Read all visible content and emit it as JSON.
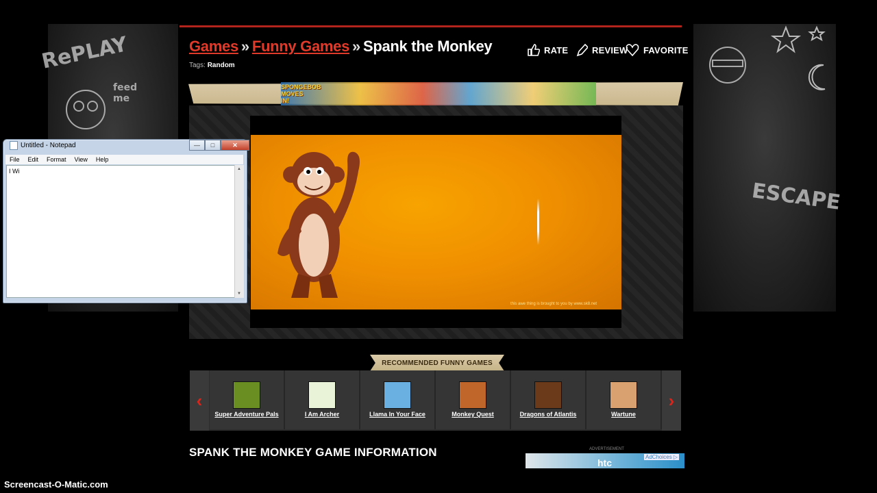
{
  "breadcrumb": {
    "games": "Games",
    "sep1": "»",
    "funny_games": "Funny Games",
    "sep2": "»",
    "current": "Spank the Monkey"
  },
  "tags": {
    "label": "Tags:",
    "value": "Random"
  },
  "actions": {
    "rate": "RATE",
    "review": "REVIEW",
    "favorite": "FAVORITE"
  },
  "banner": {
    "logo_line1": "SPONGEBOB",
    "logo_line2": "MOVES",
    "logo_line3": "IN!"
  },
  "game": {
    "credit": "this awe thing is brought to you by www.sk8.net"
  },
  "side_left": {
    "chalk1": "RePLAY",
    "chalk2": "feed me"
  },
  "side_right": {
    "chalk1": "ESCAPE"
  },
  "notepad": {
    "title": "Untitled - Notepad",
    "menu": [
      "File",
      "Edit",
      "Format",
      "View",
      "Help"
    ],
    "content": "I Wi",
    "btn_min": "—",
    "btn_max": "□",
    "btn_close": "✕"
  },
  "recommended": {
    "label": "RECOMMENDED FUNNY GAMES",
    "prev": "‹",
    "next": "›",
    "items": [
      {
        "name": "Super Adventure Pals",
        "color": "#6b8e23"
      },
      {
        "name": "I Am Archer",
        "color": "#e8f3d8"
      },
      {
        "name": "Llama In Your Face",
        "color": "#6ab0e0"
      },
      {
        "name": "Monkey Quest",
        "color": "#c0662a"
      },
      {
        "name": "Dragons of Atlantis",
        "color": "#6a3a1a"
      },
      {
        "name": "Wartune",
        "color": "#d9a070"
      }
    ]
  },
  "info_heading": "SPANK THE MONKEY GAME INFORMATION",
  "ad": {
    "label": "ADVERTISEMENT",
    "brand": "htc",
    "choices": "AdChoices ▷"
  },
  "watermark": "Screencast-O-Matic.com",
  "colors": {
    "accent_red": "#e23a2a",
    "game_orange": "#f09000"
  }
}
